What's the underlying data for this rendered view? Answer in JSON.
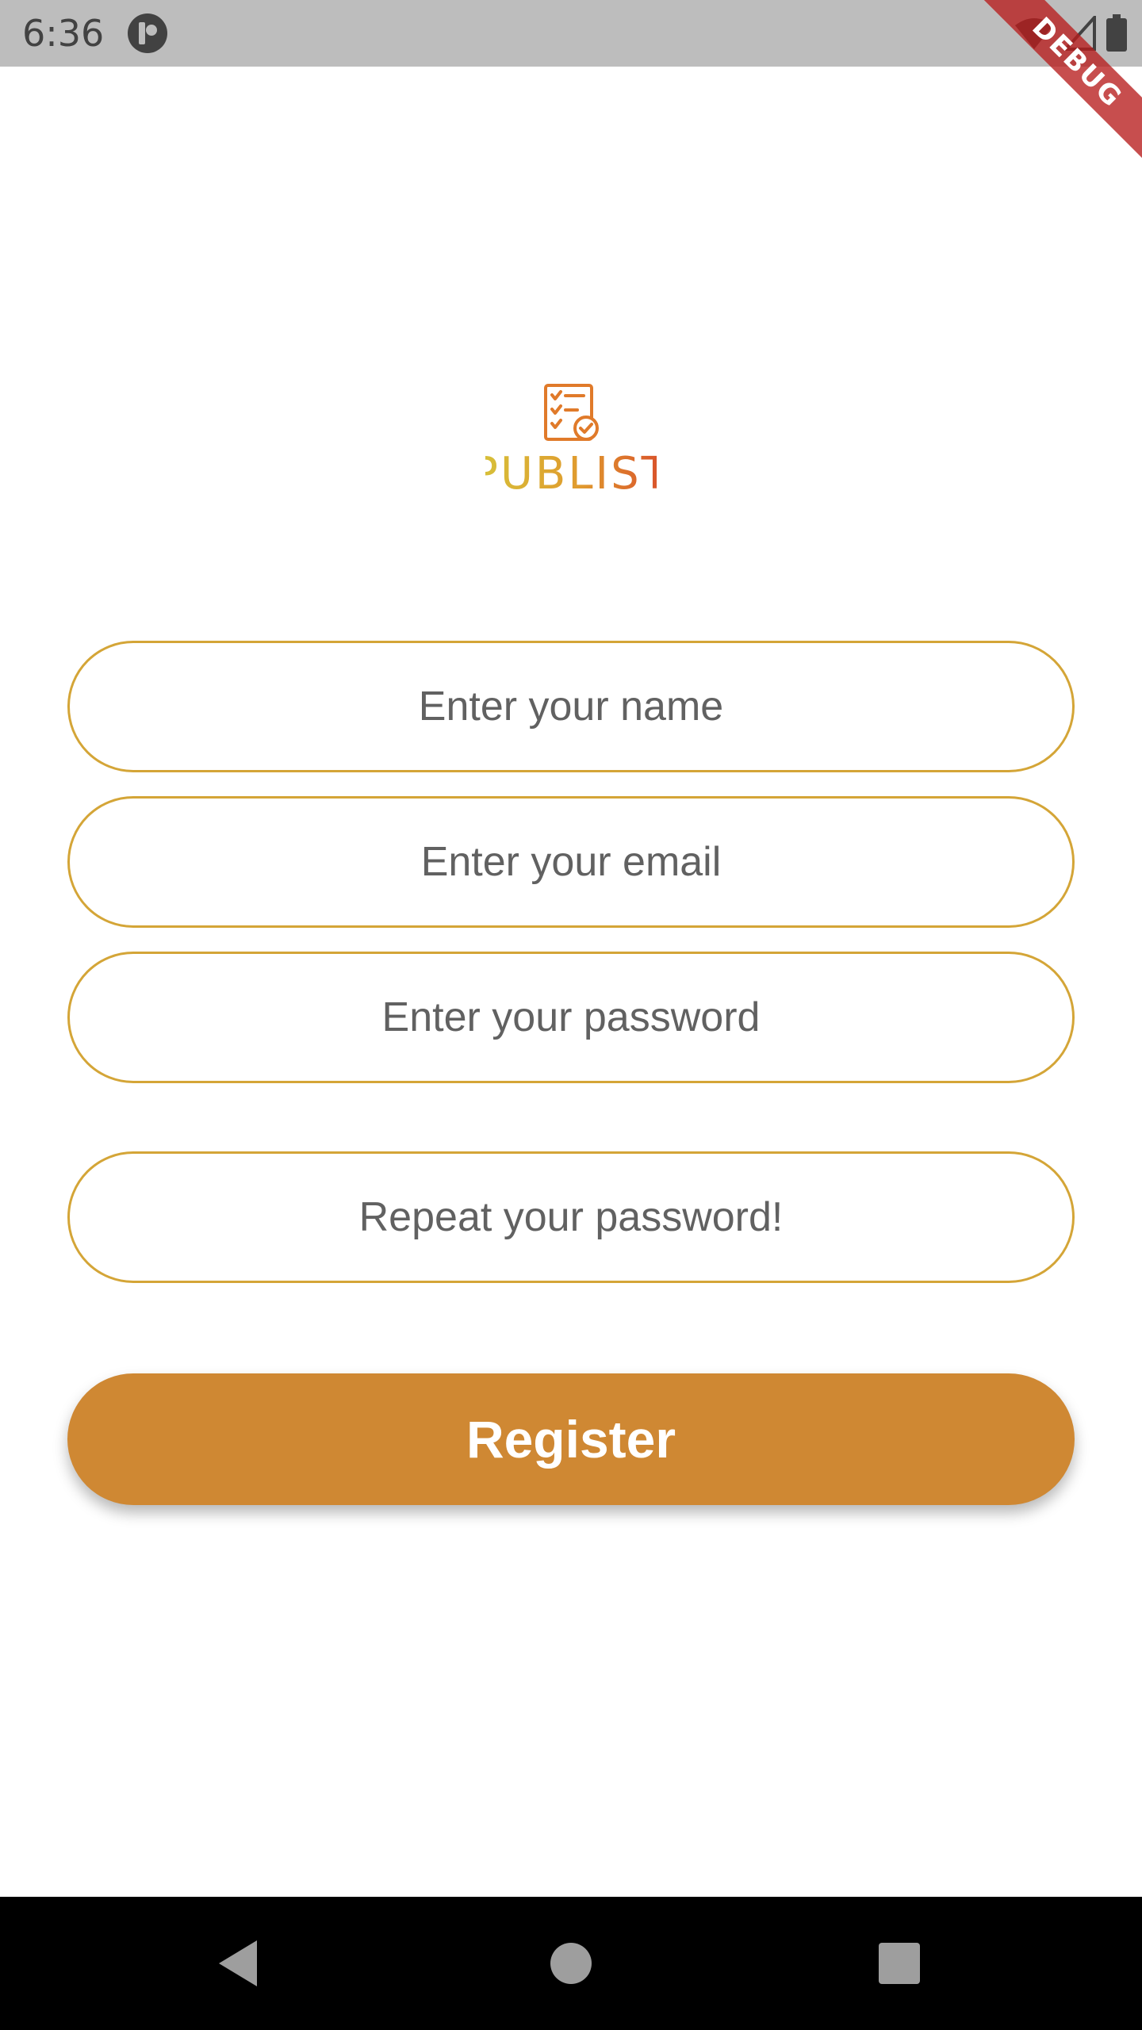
{
  "status_bar": {
    "time": "6:36",
    "icons": [
      "app-notification-icon",
      "wifi-icon",
      "cell-signal-icon",
      "battery-icon"
    ]
  },
  "debug_banner": {
    "label": "DEBUG"
  },
  "logo": {
    "text": "PUBLIST",
    "icon": "checklist-icon"
  },
  "form": {
    "name_placeholder": "Enter your name",
    "email_placeholder": "Enter your email",
    "password_placeholder": "Enter your password",
    "repeat_password_placeholder": "Repeat your password!",
    "register_label": "Register"
  },
  "colors": {
    "accent": "#cf8833",
    "field_border": "#d4a537",
    "logo_gradient": [
      "#d6c43a",
      "#d94a2a"
    ]
  },
  "nav_bar": {
    "icons": [
      "back-icon",
      "home-icon",
      "recents-icon"
    ]
  }
}
